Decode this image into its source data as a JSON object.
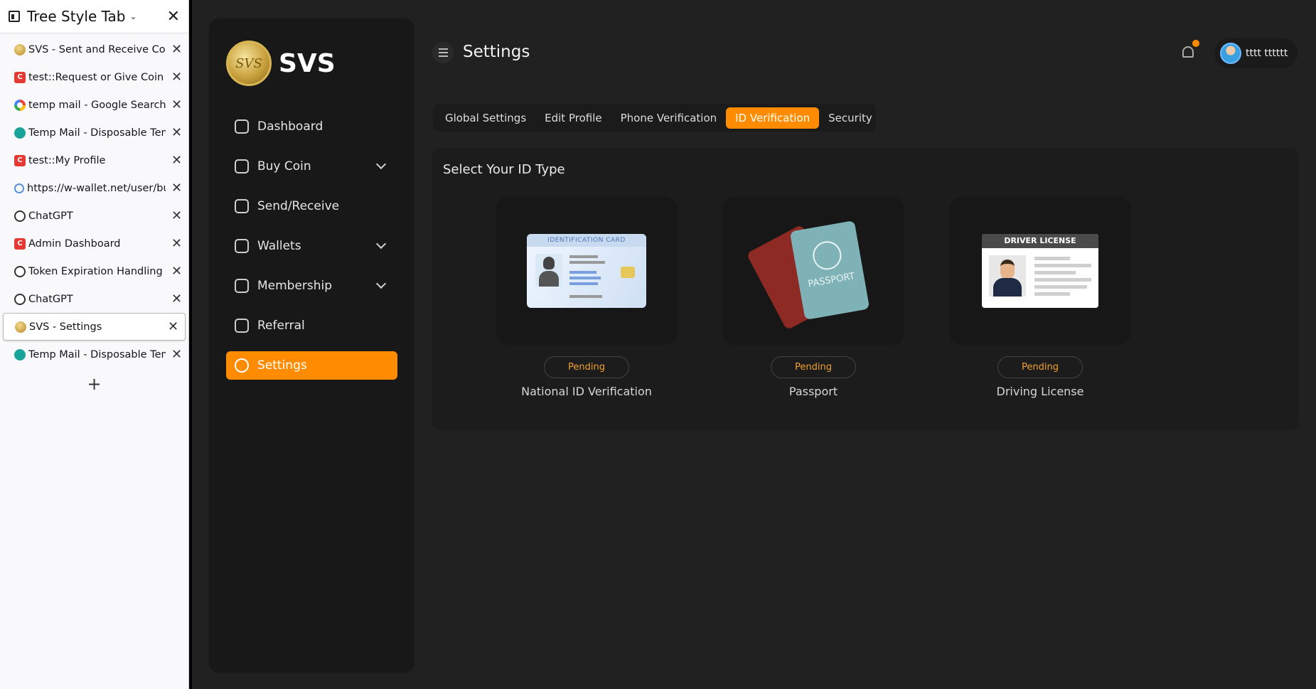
{
  "tree_style_tab": {
    "title": "Tree Style Tab",
    "new_tab": "+",
    "tabs": [
      {
        "label": "SVS - Sent and Receive Coins",
        "icon": "svs-coin"
      },
      {
        "label": "test::Request or Give Coin",
        "icon": "c-red"
      },
      {
        "label": "temp mail - Google Search",
        "icon": "google"
      },
      {
        "label": "Temp Mail - Disposable Temp",
        "icon": "tempmail"
      },
      {
        "label": "test::My Profile",
        "icon": "c-red"
      },
      {
        "label": "https://w-wallet.net/user/buy",
        "icon": "wallet-web"
      },
      {
        "label": "ChatGPT",
        "icon": "openai"
      },
      {
        "label": "Admin Dashboard",
        "icon": "c-red"
      },
      {
        "label": "Token Expiration Handling AP",
        "icon": "openai"
      },
      {
        "label": "ChatGPT",
        "icon": "openai"
      },
      {
        "label": "SVS - Settings",
        "icon": "svs-coin",
        "active": true
      },
      {
        "label": "Temp Mail - Disposable Temp",
        "icon": "tempmail"
      }
    ]
  },
  "brand": {
    "logo_text": "SVS",
    "coin_text": "SVS"
  },
  "nav": {
    "items": [
      {
        "label": "Dashboard",
        "icon": "chart-icon"
      },
      {
        "label": "Buy Coin",
        "icon": "card-icon",
        "expandable": true
      },
      {
        "label": "Send/Receive",
        "icon": "card-icon"
      },
      {
        "label": "Wallets",
        "icon": "wallet-icon",
        "expandable": true
      },
      {
        "label": "Membership",
        "icon": "badge-icon",
        "expandable": true
      },
      {
        "label": "Referral",
        "icon": "people-icon"
      },
      {
        "label": "Settings",
        "icon": "settings-icon",
        "active": true
      }
    ]
  },
  "header": {
    "title": "Settings",
    "user_name": "tttt tttttt"
  },
  "settings_tabs": [
    {
      "label": "Global Settings"
    },
    {
      "label": "Edit Profile"
    },
    {
      "label": "Phone Verification"
    },
    {
      "label": "ID Verification",
      "active": true
    },
    {
      "label": "Security"
    }
  ],
  "id_section": {
    "title": "Select Your ID Type",
    "options": [
      {
        "label": "National ID Verification",
        "status": "Pending",
        "card_header": "IDENTIFICATION CARD"
      },
      {
        "label": "Passport",
        "status": "Pending",
        "card_header": "PASSPORT"
      },
      {
        "label": "Driving License",
        "status": "Pending",
        "card_header": "DRIVER LICENSE"
      }
    ]
  },
  "colors": {
    "accent": "#ff8c00",
    "background": "#212121",
    "sidebar": "#181818",
    "pending_text": "#f0a030"
  }
}
